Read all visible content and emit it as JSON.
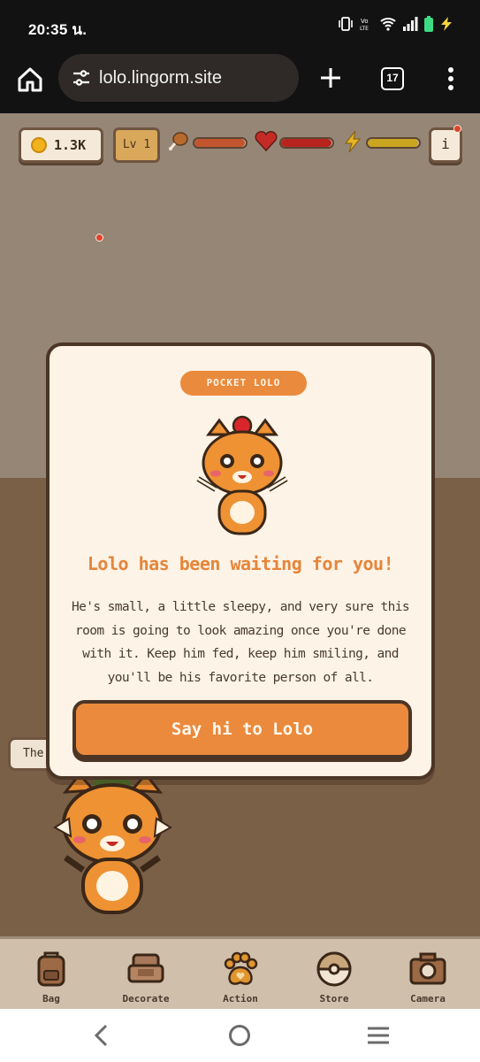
{
  "status_bar": {
    "time": "20:35 น.",
    "battery_color": "#3ddc84"
  },
  "browser": {
    "url": "lolo.lingorm.site",
    "tab_count": "17"
  },
  "hud": {
    "coins": "1.3K",
    "level": "Lv 1",
    "food_level": 0.98,
    "love_level": 0.98,
    "energy_level": 0.98,
    "info_label": "i",
    "colors": {
      "food": "#c2552e",
      "love": "#b8231e",
      "energy": "#c9a520"
    }
  },
  "speech_tab": {
    "text": "The"
  },
  "modal": {
    "badge": "POCKET LOLO",
    "title": "Lolo has been waiting for you!",
    "body": "He's small, a little sleepy, and very sure this room is going to look amazing once you're done with it. Keep him fed, keep him smiling, and you'll be his favorite person of all.",
    "button": "Say hi to Lolo"
  },
  "dock": {
    "items": [
      {
        "label": "Bag",
        "icon": "backpack-icon"
      },
      {
        "label": "Decorate",
        "icon": "armchair-icon"
      },
      {
        "label": "Action",
        "icon": "paw-icon"
      },
      {
        "label": "Store",
        "icon": "pokeball-icon"
      },
      {
        "label": "Camera",
        "icon": "camera-icon"
      }
    ]
  },
  "theme": {
    "accent": "#eb8a3c",
    "outline": "#4b3526",
    "panel": "#fdf3e6"
  }
}
